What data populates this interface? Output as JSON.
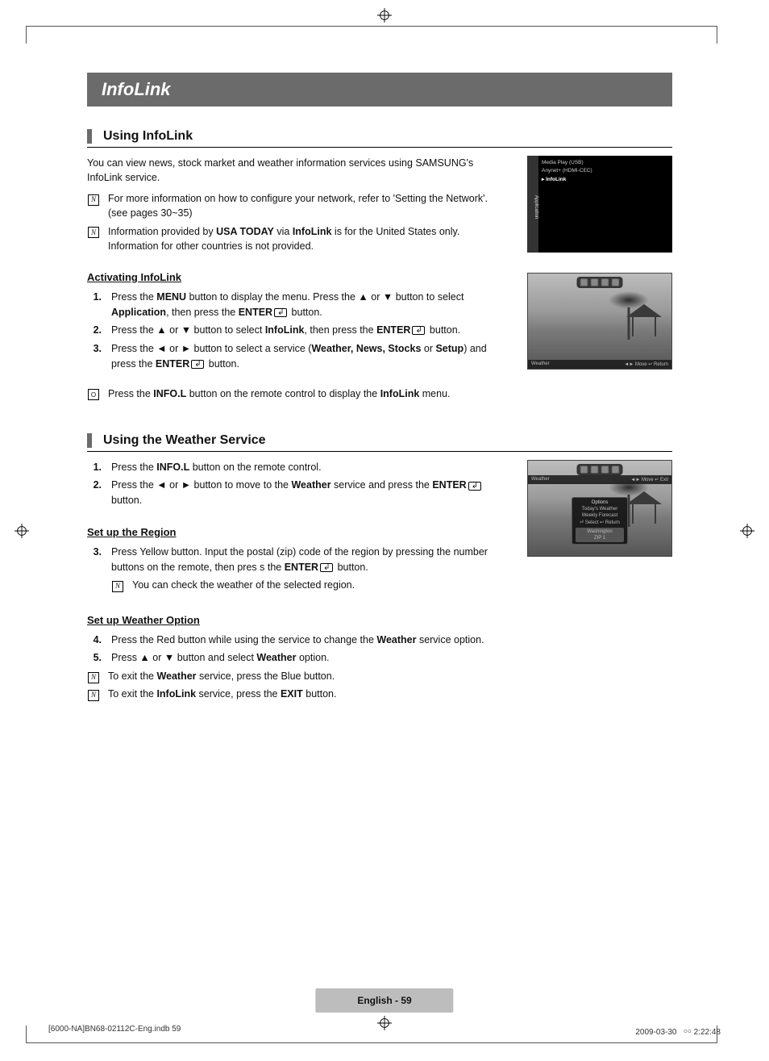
{
  "titleBar": "InfoLink",
  "section1": {
    "heading": "Using InfoLink",
    "intro": "You can view news, stock market and weather information services using SAMSUNG's InfoLink service.",
    "note1_a": "For more information on how to configure your network, refer to 'Setting the Network'. (see pages 30~35)",
    "note2_pre": "Information provided by ",
    "note2_b1": "USA TODAY",
    "note2_mid": " via ",
    "note2_b2": "InfoLink",
    "note2_post": " is for the United States only. Information for other countries is not provided."
  },
  "activating": {
    "heading": "Activating InfoLink",
    "s1_a": "Press the ",
    "s1_b1": "MENU",
    "s1_b": " button to display the menu. Press the ▲ or ▼ button to select ",
    "s1_b2": "Application",
    "s1_c": ", then press the ",
    "s1_b3": "ENTER",
    "s1_d": " button.",
    "s2_a": "Press the ▲ or ▼ button to select ",
    "s2_b1": "InfoLink",
    "s2_b": ", then press the ",
    "s2_b2": "ENTER",
    "s2_c": " button.",
    "s3_a": "Press the ◄ or ► button to select a service (",
    "s3_b1": "Weather, News, Stocks",
    "s3_b": " or ",
    "s3_b2": "Setup",
    "s3_c": ") and press the ",
    "s3_b3": "ENTER",
    "s3_d": " button.",
    "remote_a": "Press the ",
    "remote_b": "INFO.L",
    "remote_c": " button on the remote control to display the ",
    "remote_d": "InfoLink",
    "remote_e": " menu."
  },
  "section2": {
    "heading": "Using the Weather Service",
    "s1_a": "Press the ",
    "s1_b": "INFO.L",
    "s1_c": " button on the remote control.",
    "s2_a": "Press the ◄ or ► button to move to the ",
    "s2_b": "Weather",
    "s2_c": " service and press the ",
    "s2_d": "ENTER",
    "s2_e": " button."
  },
  "region": {
    "heading": "Set up the Region",
    "s3_a": "Press Yellow button. Input the postal (zip) code of the region by pressing the number buttons on the remote, then pres s the ",
    "s3_b": "ENTER",
    "s3_c": " button.",
    "note": "You can check the weather of the selected region."
  },
  "option": {
    "heading": "Set up Weather Option",
    "s4_a": "Press the Red button while using the service to change the ",
    "s4_b": "Weather",
    "s4_c": " service option.",
    "s5_a": "Press ▲ or ▼ button and select ",
    "s5_b": "Weather",
    "s5_c": " option.",
    "note1_a": "To exit the ",
    "note1_b": "Weather",
    "note1_c": " service, press the Blue button.",
    "note2_a": "To exit the ",
    "note2_b": "InfoLink",
    "note2_c": " service, press the ",
    "note2_d": "EXIT",
    "note2_e": " button."
  },
  "osd1": {
    "sidebar": "Application",
    "m1": "Media Play (USB)",
    "m2": "Anynet+ (HDMI-CEC)",
    "m3": "InfoLink"
  },
  "osd2": {
    "footL": "Weather",
    "footR": "◄► Move  ↩ Return"
  },
  "osd3": {
    "footL": "Weather",
    "footR": "◄► Move  ↵ Exit",
    "opt_h": "Options",
    "opt_1": "Today's Weather",
    "opt_2": "Weekly Forecast",
    "opt_3": "⏎ Select  ↩ Return",
    "zip_city": "Washington",
    "zip_hint": "ZIP 1"
  },
  "pageFoot": "English - 59",
  "docFoot": {
    "left": "[6000-NA]BN68-02112C-Eng.indb   59",
    "date": "2009-03-30",
    "time": "￮￮ 2:22:48"
  },
  "nums": {
    "n1": "1.",
    "n2": "2.",
    "n3": "3.",
    "n4": "4.",
    "n5": "5."
  },
  "glyphs": {
    "note": "N",
    "remote": "O"
  }
}
